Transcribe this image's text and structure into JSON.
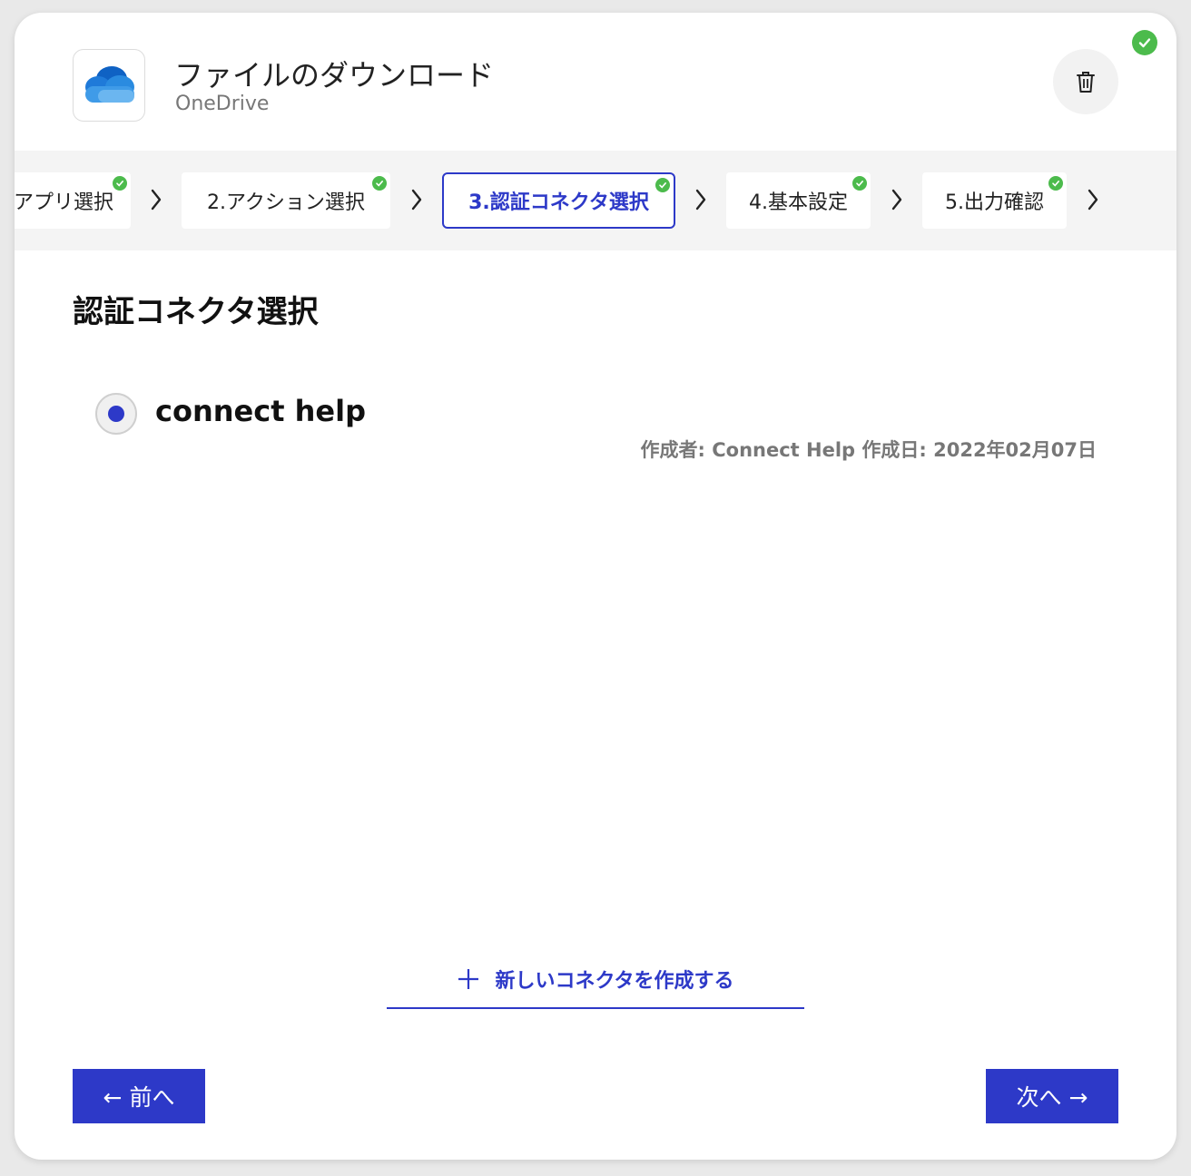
{
  "header": {
    "title": "ファイルのダウンロード",
    "subtitle": "OneDrive",
    "app_icon": "onedrive-cloud-icon",
    "delete_icon": "trash-icon",
    "status_icon": "check-circle-icon"
  },
  "steps": [
    {
      "label": "アプリ選択",
      "completed": true
    },
    {
      "label": "2.アクション選択",
      "completed": true
    },
    {
      "label": "3.認証コネクタ選択",
      "completed": true,
      "active": true
    },
    {
      "label": "4.基本設定",
      "completed": true
    },
    {
      "label": "5.出力確認",
      "completed": true
    }
  ],
  "section": {
    "title": "認証コネクタ選択"
  },
  "connectors": [
    {
      "name": "connect help",
      "meta": "作成者: Connect Help 作成日: 2022年02月07日",
      "selected": true
    }
  ],
  "create_connector": {
    "label": "新しいコネクタを作成する",
    "icon": "plus-icon"
  },
  "nav": {
    "prev_label": "← 前へ",
    "next_label": "次へ →"
  },
  "colors": {
    "accent": "#2d39c8",
    "success": "#4cbb4c",
    "stepbar_bg": "#f4f4f4"
  }
}
